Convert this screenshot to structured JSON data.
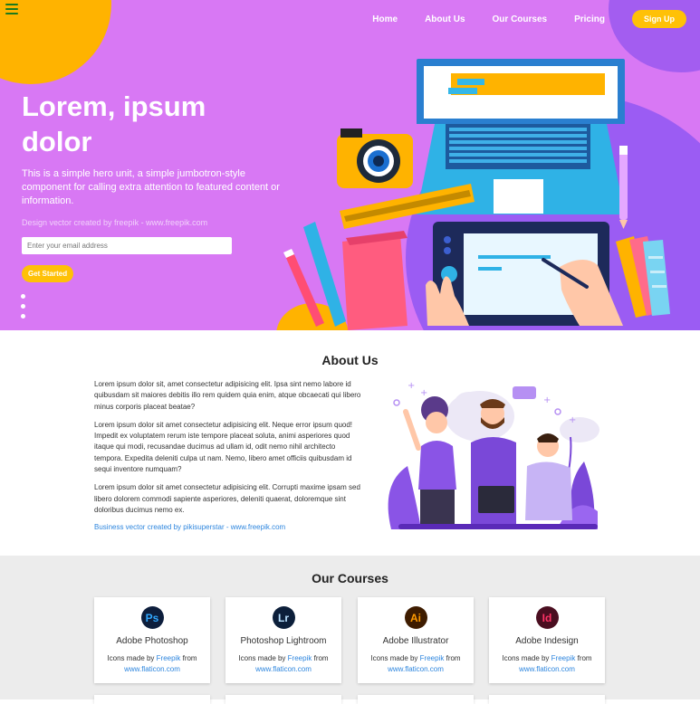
{
  "nav": {
    "items": [
      "Home",
      "About Us",
      "Our Courses",
      "Pricing"
    ],
    "signup_label": "Sign Up"
  },
  "hero": {
    "title": "Lorem, ipsum dolor",
    "description": "This is a simple hero unit, a simple jumbotron-style component for calling extra attention to featured content or information.",
    "credit": "Design vector created by freepik - www.freepik.com",
    "email_placeholder": "Enter your email address",
    "cta_label": "Get Started"
  },
  "about": {
    "title": "About Us",
    "paragraphs": [
      "Lorem ipsum dolor sit, amet consectetur adipisicing elit. Ipsa sint nemo labore id quibusdam sit maiores debitis illo rem quidem quia enim, atque obcaecati qui libero minus corporis placeat beatae?",
      "Lorem ipsum dolor sit amet consectetur adipisicing elit. Neque error ipsum quod! Impedit ex voluptatem rerum iste tempore placeat soluta, animi asperiores quod itaque qui modi, recusandae ducimus ad ullam id, odit nemo nihil architecto tempora. Expedita deleniti culpa ut nam. Nemo, libero amet officiis quibusdam id sequi inventore numquam?",
      "Lorem ipsum dolor sit amet consectetur adipisicing elit. Corrupti maxime ipsam sed libero dolorem commodi sapiente asperiores, deleniti quaerat, doloremque sint doloribus ducimus nemo ex."
    ],
    "credit": "Business vector created by pikisuperstar - www.freepik.com"
  },
  "courses": {
    "title": "Our Courses",
    "credit_prefix": "Icons made by",
    "credit_author": "Freepik",
    "credit_mid": "from",
    "credit_site": "www.flaticon.com",
    "items": [
      {
        "name": "Adobe Photoshop",
        "abbr": "Ps",
        "bg": "#0d1e3c",
        "fg": "#31a8ff",
        "icon": "photoshop-icon"
      },
      {
        "name": "Photoshop Lightroom",
        "abbr": "Lr",
        "bg": "#0c1f3a",
        "fg": "#b9e1ff",
        "icon": "lightroom-icon"
      },
      {
        "name": "Adobe Illustrator",
        "abbr": "Ai",
        "bg": "#3e1c00",
        "fg": "#ff9a00",
        "icon": "illustrator-icon"
      },
      {
        "name": "Adobe Indesign",
        "abbr": "Id",
        "bg": "#4a0e20",
        "fg": "#ff3366",
        "icon": "indesign-icon"
      }
    ]
  },
  "colors": {
    "hero_bg": "#d878f4",
    "accent": "#ffc107",
    "purple": "#9b5cf3",
    "link": "#2e86de"
  }
}
